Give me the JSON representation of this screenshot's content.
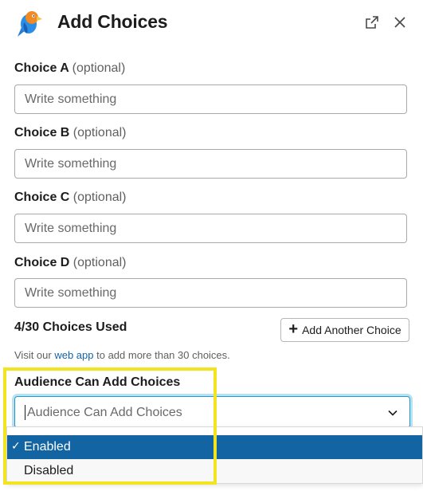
{
  "header": {
    "title": "Add Choices"
  },
  "choices": [
    {
      "label": "Choice A",
      "optional": "(optional)",
      "placeholder": "Write something"
    },
    {
      "label": "Choice B",
      "optional": "(optional)",
      "placeholder": "Write something"
    },
    {
      "label": "Choice C",
      "optional": "(optional)",
      "placeholder": "Write something"
    },
    {
      "label": "Choice D",
      "optional": "(optional)",
      "placeholder": "Write something"
    }
  ],
  "usage": {
    "text": "4/30 Choices Used",
    "used": 4,
    "limit": 30
  },
  "add_another_label": "Add Another Choice",
  "visit": {
    "prefix": "Visit our ",
    "link": "web app",
    "suffix": " to add more than 30 choices."
  },
  "audience": {
    "label": "Audience Can Add Choices",
    "placeholder": "Audience Can Add Choices",
    "options": [
      {
        "label": "Enabled",
        "selected": true
      },
      {
        "label": "Disabled",
        "selected": false
      }
    ]
  },
  "icons": {
    "logo": "parrot-logo-icon",
    "open_external": "open-external-icon",
    "close": "close-icon",
    "chevron": "chevron-down-icon",
    "plus": "plus-icon",
    "check": "checkmark-icon"
  },
  "colors": {
    "accent": "#1264a3",
    "focus": "#1d9bd1",
    "highlight": "#f2e421"
  }
}
